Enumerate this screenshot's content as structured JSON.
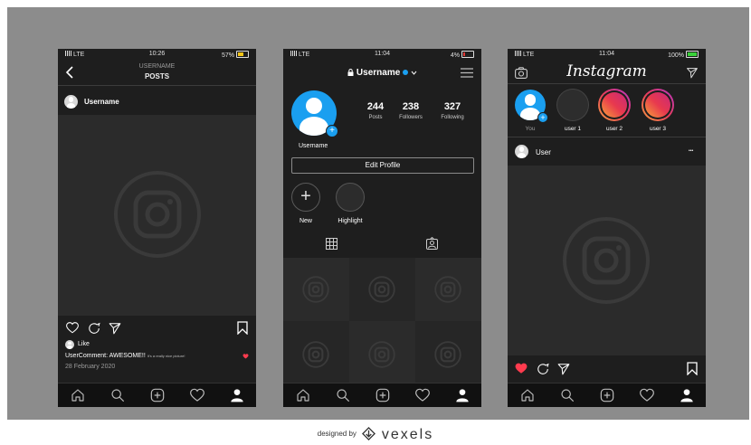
{
  "colors": {
    "background": "#8c8c8c",
    "screen": "#1e1e1e",
    "accent_blue": "#1a9ff0",
    "heart_red": "#ff3b4e",
    "battery_green": "#3ad13a",
    "battery_yellow": "#f5c518",
    "battery_red": "#e53935"
  },
  "phone1": {
    "status": {
      "carrier": "LTE",
      "time": "10:26",
      "battery": "57%"
    },
    "header": {
      "username": "USERNAME",
      "title": "POSTS"
    },
    "post_user": "Username",
    "likes_label": "Like",
    "comment_user": "User",
    "comment_text": "Comment: AWESOME!!",
    "comment_small": "It's a really nice picture!",
    "date": "28 February 2020"
  },
  "phone2": {
    "status": {
      "carrier": "LTE",
      "time": "11:04",
      "battery": "4%"
    },
    "username": "Username",
    "stats": [
      {
        "value": "244",
        "label": "Posts"
      },
      {
        "value": "238",
        "label": "Followers"
      },
      {
        "value": "327",
        "label": "Following"
      }
    ],
    "profile_name": "Username",
    "edit_profile": "Edit Profile",
    "highlights": [
      {
        "label": "New"
      },
      {
        "label": "Highlight"
      }
    ]
  },
  "phone3": {
    "status": {
      "carrier": "LTE",
      "time": "11:04",
      "battery": "100%"
    },
    "brand": "Instagram",
    "stories": [
      {
        "label": "You"
      },
      {
        "label": "user 1"
      },
      {
        "label": "user 2"
      },
      {
        "label": "user 3"
      }
    ],
    "post_user": "User",
    "more": "•••"
  },
  "footer": {
    "designed_by": "designed by",
    "brand": "vexels"
  }
}
